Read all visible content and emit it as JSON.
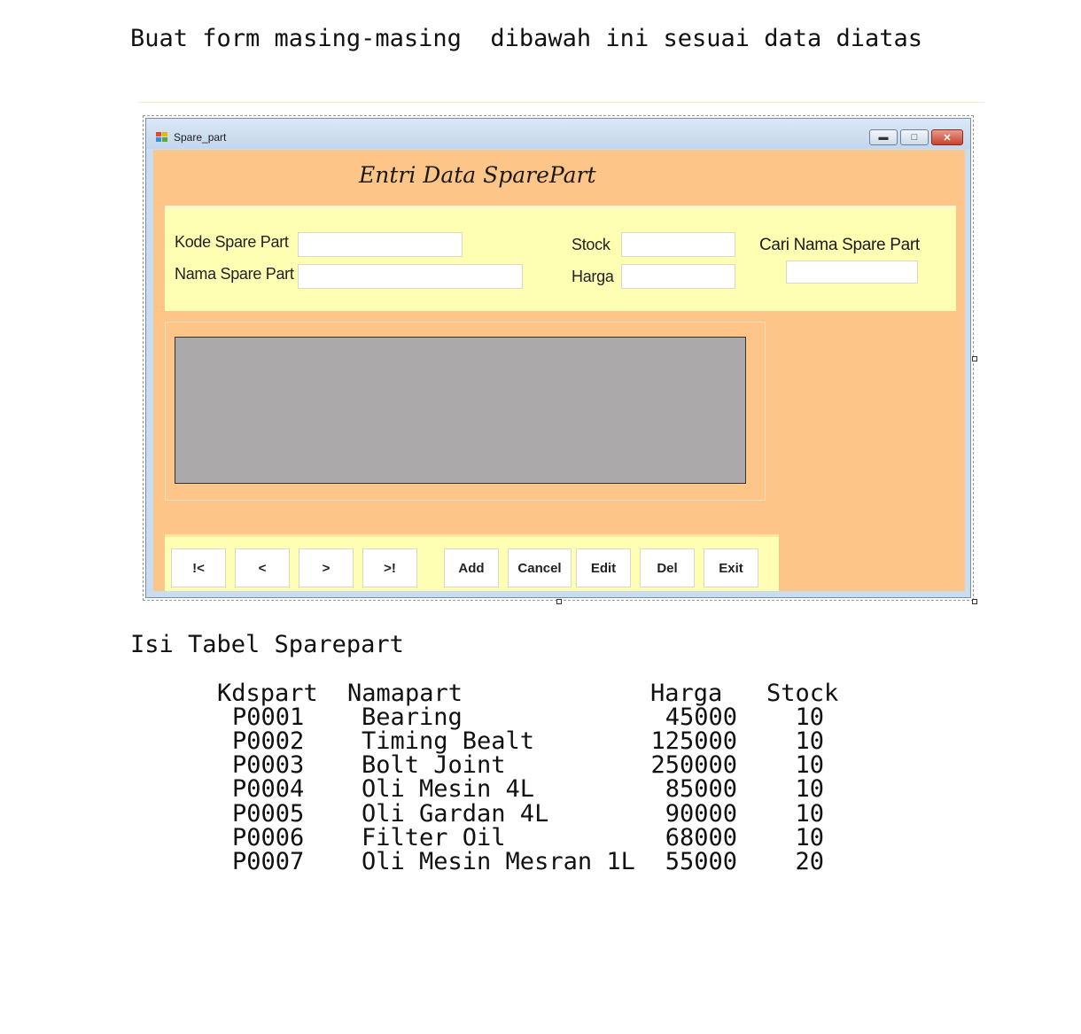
{
  "instruction": "Buat form masing-masing  dibawah ini sesuai data diatas",
  "window": {
    "title": "Spare_part",
    "heading": "Entri Data SparePart"
  },
  "fields": {
    "kode_label": "Kode Spare Part",
    "nama_label": "Nama Spare Part",
    "stock_label": "Stock",
    "harga_label": "Harga",
    "cari_label": "Cari Nama Spare Part",
    "kode_value": "",
    "nama_value": "",
    "stock_value": "",
    "harga_value": "",
    "cari_value": ""
  },
  "buttons": {
    "first": "!<",
    "prev": "<",
    "next": ">",
    "last": ">!",
    "add": "Add",
    "cancel": "Cancel",
    "edit": "Edit",
    "del": "Del",
    "exit": "Exit"
  },
  "table": {
    "caption": "Isi Tabel Sparepart",
    "headers": [
      "Kdspart",
      "Namapart",
      "Harga",
      "Stock"
    ],
    "rows": [
      [
        "P0001",
        "Bearing",
        "45000",
        "10"
      ],
      [
        "P0002",
        "Timing Bealt",
        "125000",
        "10"
      ],
      [
        "P0003",
        "Bolt Joint",
        "250000",
        "10"
      ],
      [
        "P0004",
        "Oli Mesin 4L",
        "85000",
        "10"
      ],
      [
        "P0005",
        "Oli Gardan 4L",
        "90000",
        "10"
      ],
      [
        "P0006",
        "Filter Oil",
        "68000",
        "10"
      ],
      [
        "P0007",
        "Oli Mesin Mesran 1L",
        "55000",
        "20"
      ]
    ]
  },
  "colors": {
    "form_background": "#fec589",
    "panel_background": "#ffffb3",
    "grid_background": "#aba9aa"
  }
}
